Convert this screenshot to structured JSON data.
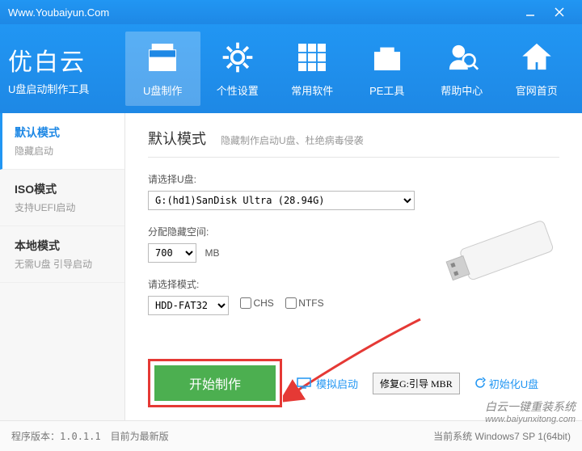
{
  "titlebar": {
    "url": "Www.Youbaiyun.Com"
  },
  "logo": {
    "title": "优白云",
    "sub": "U盘启动制作工具"
  },
  "nav": [
    {
      "label": "U盘制作"
    },
    {
      "label": "个性设置"
    },
    {
      "label": "常用软件"
    },
    {
      "label": "PE工具"
    },
    {
      "label": "帮助中心"
    },
    {
      "label": "官网首页"
    }
  ],
  "sidebar": [
    {
      "title": "默认模式",
      "sub": "隐藏启动"
    },
    {
      "title": "ISO模式",
      "sub": "支持UEFI启动"
    },
    {
      "title": "本地模式",
      "sub": "无需U盘 引导启动"
    }
  ],
  "main": {
    "title": "默认模式",
    "desc": "隐藏制作启动U盘、杜绝病毒侵袭",
    "disk_label": "请选择U盘:",
    "disk_value": "G:(hd1)SanDisk Ultra (28.94G)",
    "space_label": "分配隐藏空间:",
    "space_value": "700",
    "space_unit": "MB",
    "mode_label": "请选择模式:",
    "mode_value": "HDD-FAT32",
    "chs": "CHS",
    "ntfs": "NTFS"
  },
  "actions": {
    "primary": "开始制作",
    "simulate": "模拟启动",
    "repair": "修复G:引导 MBR",
    "init": "初始化U盘"
  },
  "status": {
    "version_label": "程序版本：",
    "version": "1.0.1.1",
    "update": "目前为最新版",
    "system": "当前系统 Windows7 SP 1(64bit)"
  },
  "watermark": {
    "line1": "白云一键重装系统",
    "line2": "www.baiyunxitong.com"
  }
}
